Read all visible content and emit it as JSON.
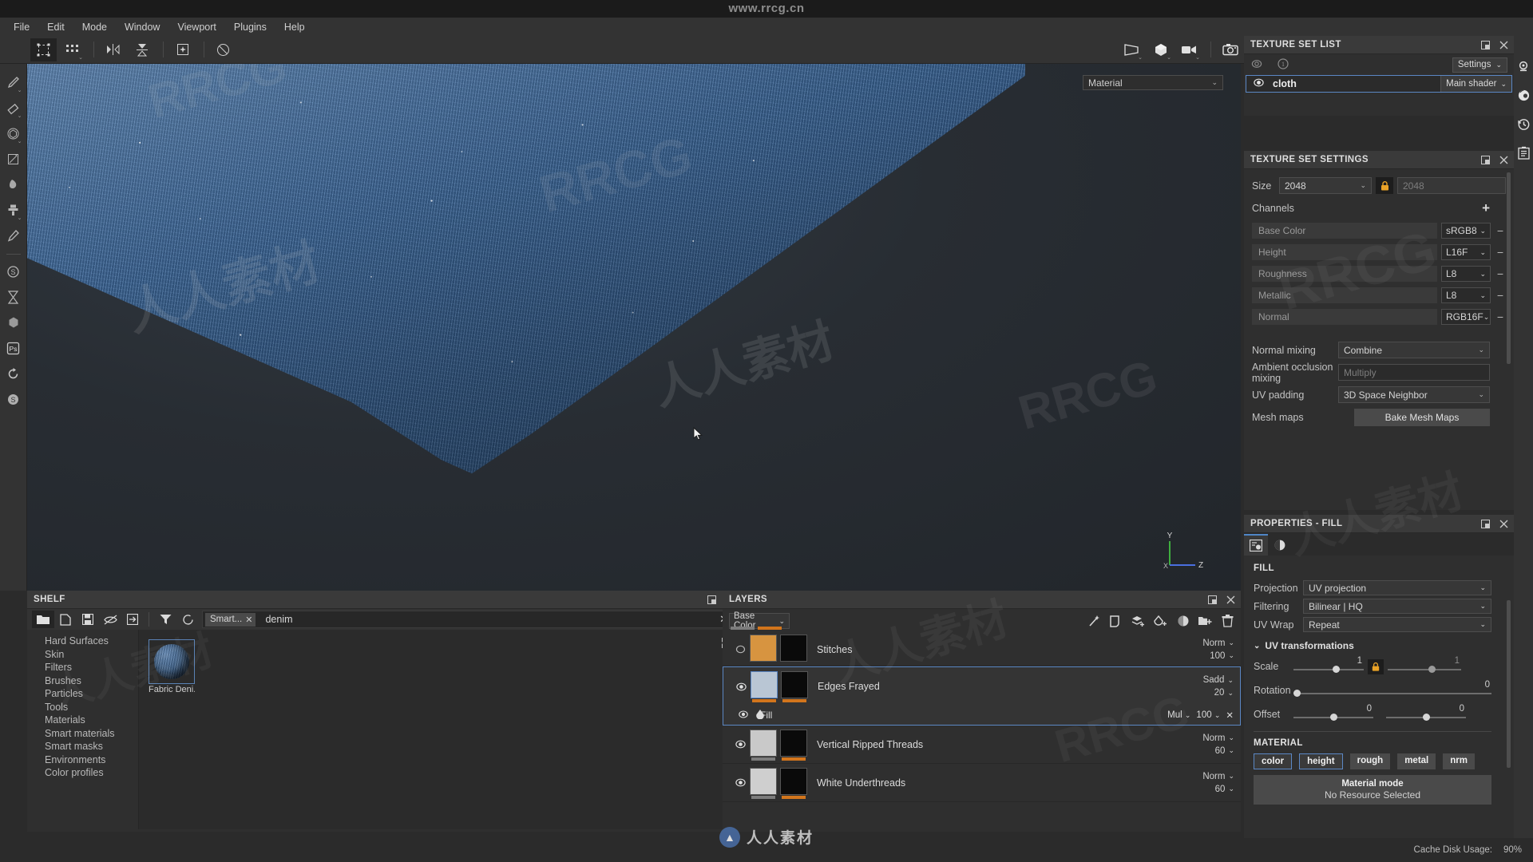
{
  "titlebar": {
    "watermark": "www.rrcg.cn"
  },
  "menubar": {
    "items": [
      "File",
      "Edit",
      "Mode",
      "Window",
      "Viewport",
      "Plugins",
      "Help"
    ]
  },
  "toolbar": {
    "buttons": [
      {
        "name": "material-tool",
        "icon": "dashed-square-icon"
      },
      {
        "name": "particles-tool",
        "icon": "dots-grid-icon"
      },
      {
        "name": "symmetry-tool",
        "icon": "mirror-icon"
      },
      {
        "name": "symmetry-plane-tool",
        "icon": "symmetry-plane-icon"
      },
      {
        "name": "projection-tool",
        "icon": "projection-icon"
      },
      {
        "name": "reset-camera",
        "icon": "reset-rotate-icon"
      }
    ],
    "view_buttons": [
      {
        "name": "view-material-mode",
        "icon": "plane-view-icon"
      },
      {
        "name": "view-3d-mode",
        "icon": "cube-view-icon"
      },
      {
        "name": "view-render-mode",
        "icon": "camera-video-icon"
      },
      {
        "name": "screenshot-button",
        "icon": "photo-camera-icon"
      }
    ]
  },
  "left_rail": {
    "tools": [
      {
        "name": "paint-brush-tool",
        "icon": "brush-icon"
      },
      {
        "name": "eraser-tool",
        "icon": "eraser-icon"
      },
      {
        "name": "projection-tool",
        "icon": "cube-icon"
      },
      {
        "name": "polygon-fill-tool",
        "icon": "polygon-fill-icon"
      },
      {
        "name": "smudge-tool",
        "icon": "smudge-icon"
      },
      {
        "name": "clone-tool",
        "icon": "clone-stamp-icon"
      },
      {
        "name": "material-picker-tool",
        "icon": "eyedropper-icon"
      },
      {
        "name": "substance-engine",
        "icon": "substance-badge-icon"
      },
      {
        "name": "baking-tool",
        "icon": "hourglass-icon"
      },
      {
        "name": "substance-source",
        "icon": "hexagon-icon"
      },
      {
        "name": "photoshop-link",
        "icon": "ps-icon"
      },
      {
        "name": "refresh-tool",
        "icon": "refresh-icon"
      },
      {
        "name": "substance-share",
        "icon": "substance-share-icon"
      }
    ]
  },
  "viewport": {
    "material_dropdown": "Material",
    "gizmo_axes": [
      "Y",
      "X",
      "Z"
    ]
  },
  "shelf": {
    "title": "SHELF",
    "tools": [
      {
        "name": "shelf-folder-button",
        "icon": "folder-icon"
      },
      {
        "name": "shelf-new-button",
        "icon": "new-file-icon"
      },
      {
        "name": "shelf-save-button",
        "icon": "save-icon"
      },
      {
        "name": "shelf-hide-button",
        "icon": "eye-off-icon"
      },
      {
        "name": "shelf-import-button",
        "icon": "import-icon"
      },
      {
        "name": "shelf-filter-button",
        "icon": "filter-funnel-icon"
      },
      {
        "name": "shelf-reload-button",
        "icon": "reload-circle-icon"
      }
    ],
    "filter_chip": "Smart...",
    "search_value": "denim",
    "categories": [
      "Hard Surfaces",
      "Skin",
      "Filters",
      "Brushes",
      "Particles",
      "Tools",
      "Materials",
      "Smart materials",
      "Smart masks",
      "Environments",
      "Color profiles"
    ],
    "assets": [
      {
        "label": "Fabric Deni..."
      }
    ]
  },
  "layers": {
    "title": "LAYERS",
    "channel_selector": "Base Color",
    "actions": [
      {
        "name": "add-effect-button",
        "icon": "magic-wand-icon"
      },
      {
        "name": "add-mask-button",
        "icon": "mask-icon"
      },
      {
        "name": "add-fill-layer-button",
        "icon": "stack-plus-icon"
      },
      {
        "name": "add-paint-layer-button",
        "icon": "drop-plus-icon"
      },
      {
        "name": "add-anchor-button",
        "icon": "anchor-circle-icon"
      },
      {
        "name": "add-folder-button",
        "icon": "folder-plus-icon"
      },
      {
        "name": "delete-layer-button",
        "icon": "trash-icon"
      }
    ],
    "rows": [
      {
        "name": "Stitches",
        "blend": "Norm",
        "opacity": "100",
        "visible": false,
        "selected": false,
        "thumb": "#d79440",
        "mask": "#000000",
        "bar_left": "#7c7c7c",
        "bar_right": "#d2751c"
      },
      {
        "name": "Edges Frayed",
        "blend": "Sadd",
        "opacity": "20",
        "visible": true,
        "selected": true,
        "thumb": "#b9c6d4",
        "mask": "#000000",
        "bar_left": "#d2751c",
        "bar_right": "#d2751c",
        "child": {
          "name": "Fill",
          "blend": "Mul",
          "opacity": "100",
          "visible": true,
          "icon": "fill-drop-icon"
        }
      },
      {
        "name": "Vertical Ripped Threads",
        "blend": "Norm",
        "opacity": "60",
        "visible": true,
        "selected": false,
        "thumb": "#c9c9c9",
        "mask": "#000000",
        "bar_left": "#7c7c7c",
        "bar_right": "#d2751c"
      },
      {
        "name": "White Underthreads",
        "blend": "Norm",
        "opacity": "60",
        "visible": true,
        "selected": false,
        "thumb": "#cfcfcf",
        "mask": "#000000",
        "bar_left": "#7c7c7c",
        "bar_right": "#d2751c"
      }
    ]
  },
  "texture_set_list": {
    "title": "TEXTURE SET LIST",
    "settings_button": "Settings",
    "rows": [
      {
        "name": "cloth",
        "shader": "Main shader"
      }
    ]
  },
  "texture_set_settings": {
    "title": "TEXTURE SET SETTINGS",
    "size_label": "Size",
    "size_value": "2048",
    "size_value_locked": "2048",
    "channels_label": "Channels",
    "channels": [
      {
        "name": "Base Color",
        "format": "sRGB8"
      },
      {
        "name": "Height",
        "format": "L16F"
      },
      {
        "name": "Roughness",
        "format": "L8"
      },
      {
        "name": "Metallic",
        "format": "L8"
      },
      {
        "name": "Normal",
        "format": "RGB16F"
      }
    ],
    "normal_mixing_label": "Normal mixing",
    "normal_mixing_value": "Combine",
    "ao_mixing_label": "Ambient occlusion mixing",
    "ao_mixing_value": "Multiply",
    "uv_padding_label": "UV padding",
    "uv_padding_value": "3D Space Neighbor",
    "mesh_maps_label": "Mesh maps",
    "bake_button": "Bake Mesh Maps"
  },
  "properties": {
    "title": "PROPERTIES - FILL",
    "tabs": [
      {
        "name": "tab-fill-properties",
        "icon": "fill-settings-icon",
        "active": true
      },
      {
        "name": "tab-material-properties",
        "icon": "sphere-shade-icon",
        "active": false
      }
    ],
    "fill_section": "FILL",
    "projection_label": "Projection",
    "projection_value": "UV projection",
    "filtering_label": "Filtering",
    "filtering_value": "Bilinear | HQ",
    "uvwrap_label": "UV Wrap",
    "uvwrap_value": "Repeat",
    "uv_transform_label": "UV transformations",
    "scale_label": "Scale",
    "scale_u": "1",
    "scale_v": "1",
    "rotation_label": "Rotation",
    "rotation_value": "0",
    "offset_label": "Offset",
    "offset_u": "0",
    "offset_v": "0",
    "material_section": "MATERIAL",
    "material_channels": [
      {
        "label": "color",
        "on": true
      },
      {
        "label": "height",
        "on": true
      },
      {
        "label": "rough",
        "on": false
      },
      {
        "label": "metal",
        "on": false
      },
      {
        "label": "nrm",
        "on": false
      }
    ],
    "material_mode_title": "Material mode",
    "material_mode_sub": "No Resource Selected"
  },
  "right_rail": {
    "buttons": [
      {
        "name": "display-settings-button",
        "icon": "gear-icon"
      },
      {
        "name": "shader-settings-button",
        "icon": "sphere-gear-icon"
      },
      {
        "name": "history-button",
        "icon": "clock-icon"
      },
      {
        "name": "log-button",
        "icon": "list-document-icon"
      }
    ]
  },
  "status_bar": {
    "cache_label": "Cache Disk Usage:",
    "cache_value": "90%"
  },
  "watermarks": {
    "brand_text": "人人素材",
    "tiles": [
      "RRCG",
      "人人素材"
    ]
  }
}
